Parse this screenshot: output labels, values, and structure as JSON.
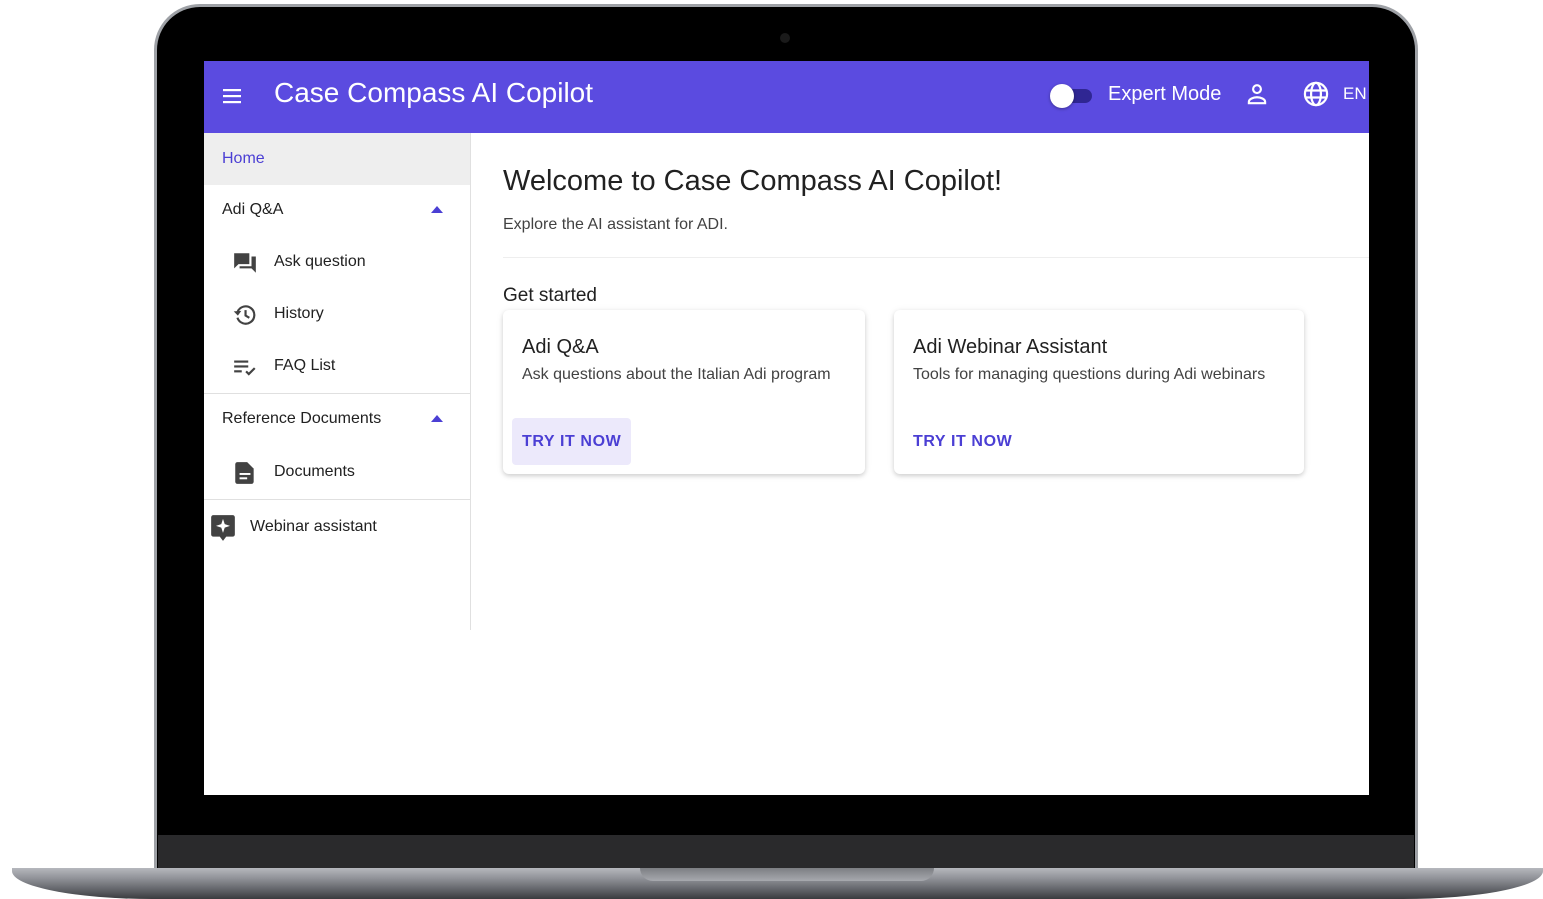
{
  "app": {
    "title": "Case Compass AI Copilot",
    "brand_color": "#5b4be0",
    "accent_color": "#4b3fd4"
  },
  "header": {
    "menu_icon": "menu-icon",
    "expert_mode": {
      "label": "Expert Mode",
      "enabled": false
    },
    "account_icon": "account-icon",
    "language": {
      "icon": "globe-icon",
      "label": "EN"
    }
  },
  "sidebar": {
    "home": {
      "label": "Home",
      "selected": true
    },
    "groups": [
      {
        "label": "Adi Q&A",
        "expanded": true,
        "items": [
          {
            "label": "Ask question",
            "icon": "forum-icon"
          },
          {
            "label": "History",
            "icon": "history-icon"
          },
          {
            "label": "FAQ List",
            "icon": "checklist-icon"
          }
        ]
      },
      {
        "label": "Reference Documents",
        "expanded": true,
        "items": [
          {
            "label": "Documents",
            "icon": "document-icon"
          }
        ]
      }
    ],
    "webinar": {
      "label": "Webinar assistant",
      "icon": "webinar-icon"
    }
  },
  "main": {
    "title": "Welcome to Case Compass AI Copilot!",
    "subtitle": "Explore the AI assistant for ADI.",
    "section_title": "Get started",
    "cards": [
      {
        "title": "Adi Q&A",
        "description": "Ask questions about the Italian Adi program",
        "button": "TRY IT NOW"
      },
      {
        "title": "Adi Webinar Assistant",
        "description": "Tools for managing questions during Adi webinars",
        "button": "TRY IT NOW"
      }
    ]
  }
}
